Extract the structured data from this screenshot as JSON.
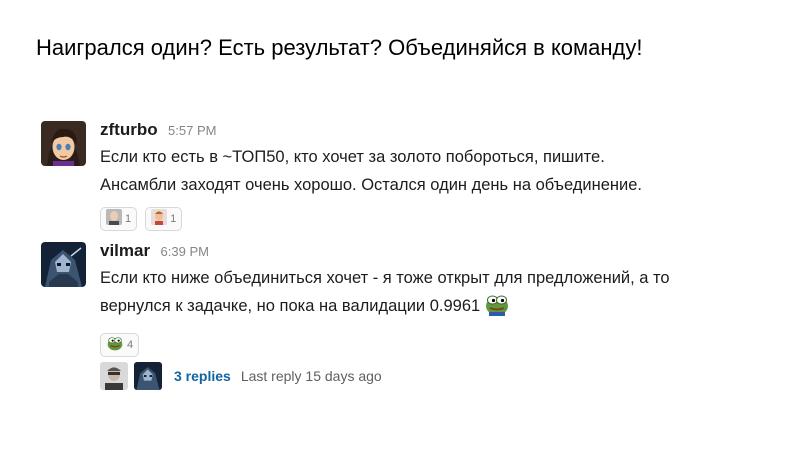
{
  "slide": {
    "title": "Наигрался один? Есть результат? Объединяйся в команду!"
  },
  "messages": [
    {
      "author": "zfturbo",
      "time": "5:57 PM",
      "lines": [
        "Если кто есть в ~ТОП50, кто хочет за золото побороться, пишите.",
        "Ансамбли заходят очень хорошо. Остался один день на объединение."
      ],
      "reactions": [
        {
          "emoji": "face-emoji-icon",
          "count": "1"
        },
        {
          "emoji": "face-emoji-icon",
          "count": "1"
        }
      ]
    },
    {
      "author": "vilmar",
      "time": "6:39 PM",
      "lines": [
        "Если кто ниже объединиться хочет - я тоже открыт для предложений, а то",
        "вернулся к задачке, но пока на валидации 0.9961"
      ],
      "inline_emoji": "pepe-frog-icon",
      "reactions": [
        {
          "emoji": "pepe-frog-icon",
          "count": "4"
        }
      ]
    }
  ],
  "thread": {
    "replies": "3 replies",
    "last_reply": "Last reply 15 days ago"
  },
  "colors": {
    "link": "#1264a3",
    "muted": "#868686",
    "text": "#1d1c1d"
  }
}
